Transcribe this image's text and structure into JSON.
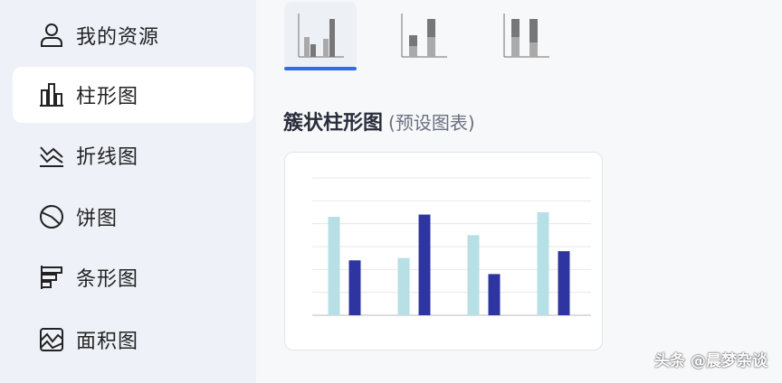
{
  "sidebar": {
    "items": [
      {
        "label": "我的资源",
        "icon": "user-icon"
      },
      {
        "label": "柱形图",
        "icon": "bar-chart-icon"
      },
      {
        "label": "折线图",
        "icon": "line-chart-icon"
      },
      {
        "label": "饼图",
        "icon": "pie-chart-icon"
      },
      {
        "label": "条形图",
        "icon": "horizontal-bar-chart-icon"
      },
      {
        "label": "面积图",
        "icon": "area-chart-icon"
      }
    ],
    "active_index": 1
  },
  "chart_types": [
    {
      "name": "clustered-column",
      "selected": true
    },
    {
      "name": "stacked-column",
      "selected": false
    },
    {
      "name": "percent-stacked-column",
      "selected": false
    }
  ],
  "section": {
    "title": "簇状柱形图",
    "subtitle": "(预设图表)"
  },
  "colors": {
    "accent": "#2f6cf6",
    "series_light": "#b7dfe6",
    "series_dark": "#2e35a0"
  },
  "watermark": "头条 @晨梦杂谈",
  "chart_data": {
    "type": "bar",
    "title": "",
    "categories": [
      "",
      "",
      "",
      ""
    ],
    "series": [
      {
        "values": [
          4.3,
          2.5,
          3.5,
          4.5
        ]
      },
      {
        "values": [
          2.4,
          4.4,
          1.8,
          2.8
        ]
      }
    ],
    "ylim": [
      0,
      6
    ],
    "grid": true,
    "legend": "bottom"
  }
}
